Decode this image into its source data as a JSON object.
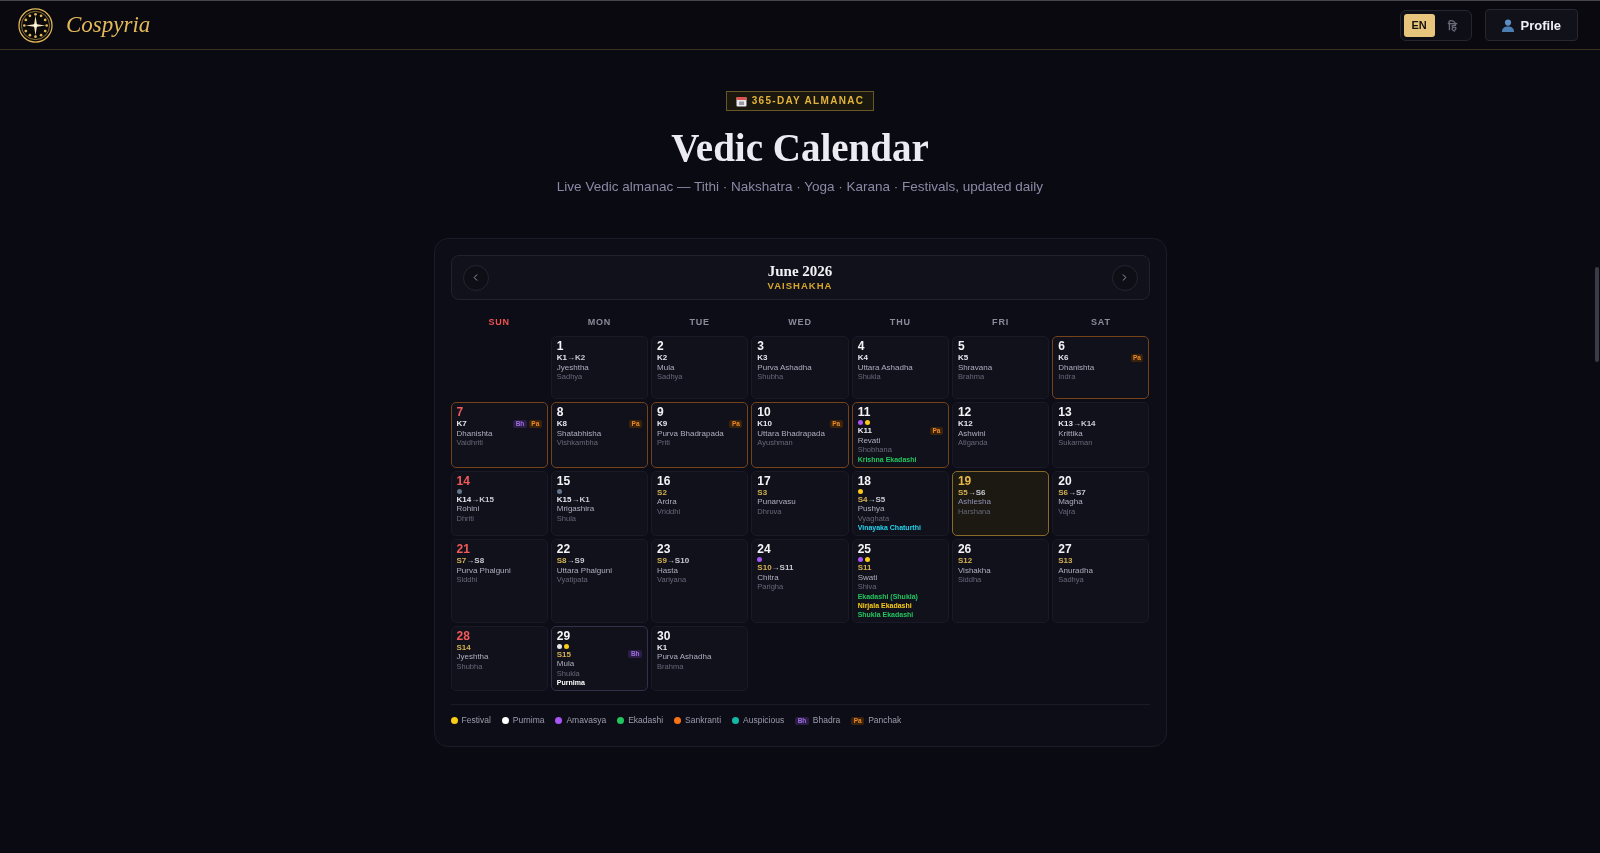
{
  "header": {
    "brand": "Cospyria",
    "languages": [
      {
        "label": "EN",
        "selected": true
      },
      {
        "label": "हि",
        "selected": false
      }
    ],
    "profile_button": "Profile"
  },
  "hero": {
    "badge": "365-DAY ALMANAC",
    "title": "Vedic Calendar",
    "subtitle": "Live Vedic almanac — Tithi · Nakshatra · Yoga · Karana · Festivals, updated daily"
  },
  "calendar": {
    "month": "June 2026",
    "lunar_month": "VAISHAKHA",
    "weekdays": [
      {
        "label": "SUN",
        "holiday": true
      },
      {
        "label": "MON",
        "holiday": false
      },
      {
        "label": "TUE",
        "holiday": false
      },
      {
        "label": "WED",
        "holiday": false
      },
      {
        "label": "THU",
        "holiday": false
      },
      {
        "label": "FRI",
        "holiday": false
      },
      {
        "label": "SAT",
        "holiday": false
      }
    ],
    "weeks": [
      [
        {
          "day": "1",
          "selected": false,
          "tithi": "K1",
          "tithi_next": "→K2",
          "shukla": false,
          "nakshatra": "Jyeshtha",
          "yoga": "Sadhya"
        },
        {
          "day": "2",
          "selected": false,
          "tithi": "K2",
          "shukla": false,
          "nakshatra": "Mula",
          "yoga": "Sadhya"
        },
        {
          "day": "3",
          "selected": false,
          "tithi": "K3",
          "shukla": false,
          "nakshatra": "Purva Ashadha",
          "yoga": "Shubha"
        },
        {
          "day": "4",
          "selected": false,
          "tithi": "K4",
          "shukla": false,
          "nakshatra": "Uttara Ashadha",
          "yoga": "Shukla"
        },
        {
          "day": "5",
          "selected": false,
          "tithi": "K5",
          "shukla": false,
          "nakshatra": "Shravana",
          "yoga": "Brahma"
        },
        {
          "day": "6",
          "selected": false,
          "tithi": "K6",
          "shukla": false,
          "nakshatra": "Dhanishta",
          "yoga": "Indra",
          "badges": [
            {
              "label": "Pa",
              "kind": "panchak"
            }
          ]
        }
      ],
      [
        {
          "day": "7",
          "selected": false,
          "tithi": "K7",
          "shukla": false,
          "nakshatra": "Dhanishta",
          "yoga": "Vaidhriti",
          "badges": [
            {
              "label": "Bh",
              "kind": "bhadra"
            },
            {
              "label": "Pa",
              "kind": "panchak"
            }
          ]
        },
        {
          "day": "8",
          "selected": false,
          "tithi": "K8",
          "shukla": false,
          "nakshatra": "Shatabhisha",
          "yoga": "Vishkambha",
          "badges": [
            {
              "label": "Pa",
              "kind": "panchak"
            }
          ]
        },
        {
          "day": "9",
          "selected": false,
          "tithi": "K9",
          "shukla": false,
          "nakshatra": "Purva Bhadrapada",
          "yoga": "Priti",
          "badges": [
            {
              "label": "Pa",
              "kind": "panchak"
            }
          ]
        },
        {
          "day": "10",
          "selected": false,
          "tithi": "K10",
          "shukla": false,
          "nakshatra": "Uttara Bhadrapada",
          "yoga": "Ayushman",
          "badges": [
            {
              "label": "Pa",
              "kind": "panchak"
            }
          ]
        },
        {
          "day": "11",
          "selected": false,
          "dots": [
            {
              "color": "#a855f7"
            },
            {
              "color": "#facc15"
            }
          ],
          "tithi": "K11",
          "shukla": false,
          "nakshatra": "Revati",
          "yoga": "Shobhana",
          "badges": [
            {
              "label": "Pa",
              "kind": "panchak"
            }
          ],
          "festivals": [
            {
              "name": "Krishna Ekadashi",
              "color": "#22c55e"
            }
          ]
        },
        {
          "day": "12",
          "selected": false,
          "tithi": "K12",
          "shukla": false,
          "nakshatra": "Ashwini",
          "yoga": "Atiganda"
        },
        {
          "day": "13",
          "selected": false,
          "tithi": "K13",
          "tithi_next": "→K14",
          "shukla": false,
          "nakshatra": "Krittika",
          "yoga": "Sukarman"
        }
      ],
      [
        {
          "day": "14",
          "selected": false,
          "dots": [
            {
              "color": "#64748b"
            }
          ],
          "tithi": "K14",
          "tithi_next": "→K15",
          "shukla": false,
          "nakshatra": "Rohini",
          "yoga": "Dhriti"
        },
        {
          "day": "15",
          "selected": false,
          "dots": [
            {
              "color": "#64748b"
            }
          ],
          "tithi": "K15",
          "tithi_next": "→K1",
          "shukla": false,
          "nakshatra": "Mrigashira",
          "yoga": "Shula"
        },
        {
          "day": "16",
          "selected": false,
          "tithi": "S2",
          "shukla": true,
          "nakshatra": "Ardra",
          "yoga": "Vriddhi"
        },
        {
          "day": "17",
          "selected": false,
          "tithi": "S3",
          "shukla": true,
          "nakshatra": "Punarvasu",
          "yoga": "Dhruva"
        },
        {
          "day": "18",
          "selected": false,
          "dots": [
            {
              "color": "#facc15"
            }
          ],
          "tithi": "S4",
          "tithi_next": "→S5",
          "shukla": true,
          "nakshatra": "Pushya",
          "yoga": "Vyaghata",
          "festivals": [
            {
              "name": "Vinayaka Chaturthi",
              "color": "#22d3ee"
            }
          ]
        },
        {
          "day": "19",
          "selected": true,
          "tithi": "S5",
          "tithi_next": "→S6",
          "shukla": true,
          "nakshatra": "Ashlesha",
          "yoga": "Harshana"
        },
        {
          "day": "20",
          "selected": false,
          "tithi": "S6",
          "tithi_next": "→S7",
          "shukla": true,
          "nakshatra": "Magha",
          "yoga": "Vajra"
        }
      ],
      [
        {
          "day": "21",
          "selected": false,
          "tithi": "S7",
          "tithi_next": "→S8",
          "shukla": true,
          "nakshatra": "Purva Phalguni",
          "yoga": "Siddhi"
        },
        {
          "day": "22",
          "selected": false,
          "tithi": "S8",
          "tithi_next": "→S9",
          "shukla": true,
          "nakshatra": "Uttara Phalguni",
          "yoga": "Vyatipata"
        },
        {
          "day": "23",
          "selected": false,
          "tithi": "S9",
          "tithi_next": "→S10",
          "shukla": true,
          "nakshatra": "Hasta",
          "yoga": "Variyana"
        },
        {
          "day": "24",
          "selected": false,
          "dots": [
            {
              "color": "#a855f7"
            }
          ],
          "tithi": "S10",
          "tithi_next": "→S11",
          "shukla": true,
          "nakshatra": "Chitra",
          "yoga": "Parigha"
        },
        {
          "day": "25",
          "selected": false,
          "dots": [
            {
              "color": "#a855f7"
            },
            {
              "color": "#facc15"
            }
          ],
          "tithi": "S11",
          "shukla": true,
          "nakshatra": "Swati",
          "yoga": "Shiva",
          "festivals": [
            {
              "name": "Ekadashi (Shukla)",
              "color": "#22c55e"
            },
            {
              "name": "Nirjala Ekadashi",
              "color": "#facc15"
            },
            {
              "name": "Shukla Ekadashi",
              "color": "#22c55e"
            }
          ]
        },
        {
          "day": "26",
          "selected": false,
          "tithi": "S12",
          "shukla": true,
          "nakshatra": "Vishakha",
          "yoga": "Siddha"
        },
        {
          "day": "27",
          "selected": false,
          "tithi": "S13",
          "shukla": true,
          "nakshatra": "Anuradha",
          "yoga": "Sadhya"
        }
      ],
      [
        {
          "day": "28",
          "selected": false,
          "tithi": "S14",
          "shukla": true,
          "nakshatra": "Jyeshtha",
          "yoga": "Shubha"
        },
        {
          "day": "29",
          "selected": false,
          "dots": [
            {
              "color": "#e5e7eb"
            },
            {
              "color": "#facc15"
            }
          ],
          "tithi": "S15",
          "shukla": true,
          "nakshatra": "Mula",
          "yoga": "Shukla",
          "badges": [
            {
              "label": "Bh",
              "kind": "bhadra"
            }
          ],
          "festivals": [
            {
              "name": "Purnima",
              "color": "#ffffff"
            }
          ]
        },
        {
          "day": "30",
          "selected": false,
          "tithi": "K1",
          "shukla": false,
          "nakshatra": "Purva Ashadha",
          "yoga": "Brahma"
        }
      ]
    ],
    "legend": [
      {
        "kind": "dot",
        "color": "#facc15",
        "label": "Festival"
      },
      {
        "kind": "dot",
        "color": "#ffffff",
        "label": "Purnima"
      },
      {
        "kind": "dot",
        "color": "#a855f7",
        "label": "Amavasya"
      },
      {
        "kind": "dot",
        "color": "#22c55e",
        "label": "Ekadashi"
      },
      {
        "kind": "dot",
        "color": "#f97316",
        "label": "Sankranti"
      },
      {
        "kind": "dot",
        "color": "#14b8a6",
        "label": "Auspicious"
      },
      {
        "kind": "badge",
        "badge": {
          "label": "Bh",
          "kind": "bhadra"
        },
        "label": "Bhadra"
      },
      {
        "kind": "badge",
        "badge": {
          "label": "Pa",
          "kind": "panchak"
        },
        "label": "Panchak"
      }
    ]
  }
}
